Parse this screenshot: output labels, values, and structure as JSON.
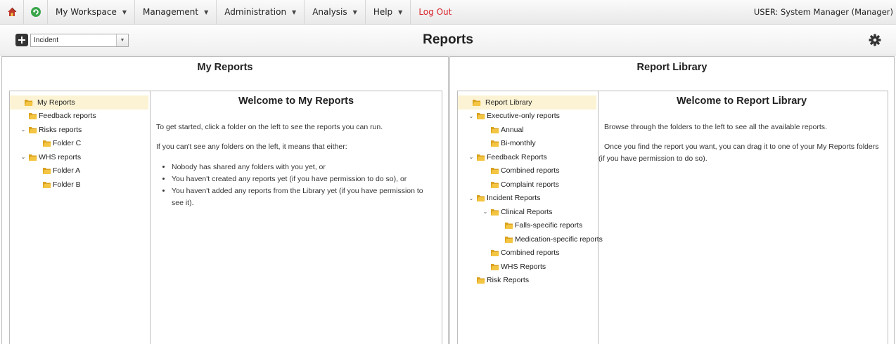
{
  "menubar": {
    "items": [
      {
        "label": "My Workspace",
        "caret": "▼"
      },
      {
        "label": "Management",
        "caret": "▼"
      },
      {
        "label": "Administration",
        "caret": "▼"
      },
      {
        "label": "Analysis",
        "caret": "▼"
      },
      {
        "label": "Help",
        "caret": "▼"
      }
    ],
    "logout_label": "Log Out",
    "user_label": "USER: System Manager (Manager)"
  },
  "header": {
    "select_value": "Incident",
    "title": "Reports"
  },
  "my_reports": {
    "panel_title": "My Reports",
    "tree": [
      {
        "label": "My Reports",
        "level": 0,
        "toggle": "",
        "selected": true
      },
      {
        "label": "Feedback reports",
        "level": 1,
        "toggle": ""
      },
      {
        "label": "Risks reports",
        "level": 1,
        "toggle": "⌄"
      },
      {
        "label": "Folder C",
        "level": 2,
        "toggle": ""
      },
      {
        "label": "WHS reports",
        "level": 1,
        "toggle": "⌄"
      },
      {
        "label": "Folder A",
        "level": 2,
        "toggle": ""
      },
      {
        "label": "Folder B",
        "level": 2,
        "toggle": ""
      }
    ],
    "welcome_title": "Welcome to My Reports",
    "intro": "To get started, click a folder on the left to see the reports you can run.",
    "either": "If you can't see any folders on the left, it means that either:",
    "bullets": [
      "Nobody has shared any folders with you yet, or",
      "You haven't created any reports yet (if you have permission to do so), or",
      "You haven't added any reports from the Library yet (if you have permission to see it)."
    ]
  },
  "library": {
    "panel_title": "Report Library",
    "tree": [
      {
        "label": "Report Library",
        "level": 0,
        "toggle": "",
        "selected": true
      },
      {
        "label": "Executive-only reports",
        "level": 1,
        "toggle": "⌄"
      },
      {
        "label": "Annual",
        "level": 2,
        "toggle": ""
      },
      {
        "label": "Bi-monthly",
        "level": 2,
        "toggle": ""
      },
      {
        "label": "Feedback Reports",
        "level": 1,
        "toggle": "⌄"
      },
      {
        "label": "Combined reports",
        "level": 2,
        "toggle": ""
      },
      {
        "label": "Complaint reports",
        "level": 2,
        "toggle": ""
      },
      {
        "label": "Incident Reports",
        "level": 1,
        "toggle": "⌄"
      },
      {
        "label": "Clinical Reports",
        "level": 2,
        "toggle": "⌄"
      },
      {
        "label": "Falls-specific reports",
        "level": 3,
        "toggle": ""
      },
      {
        "label": "Medication-specific reports",
        "level": 3,
        "toggle": ""
      },
      {
        "label": "Combined reports",
        "level": 2,
        "toggle": ""
      },
      {
        "label": "WHS Reports",
        "level": 2,
        "toggle": ""
      },
      {
        "label": "Risk Reports",
        "level": 1,
        "toggle": ""
      }
    ],
    "welcome_title": "Welcome to Report Library",
    "p1": "Browse through the folders to the left to see all the available reports.",
    "p2": "Once you find the report you want, you can drag it to one of your My Reports folders (if you have permission to do so)."
  },
  "colors": {
    "accent_red": "#d9222a",
    "selected_row": "#fbf3d3",
    "folder": "#e8b52a"
  }
}
